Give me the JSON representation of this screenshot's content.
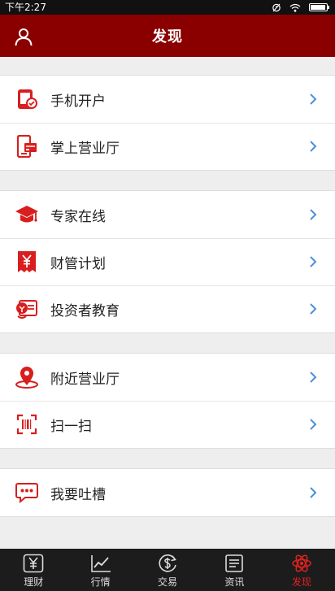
{
  "status": {
    "time": "下午2:27"
  },
  "header": {
    "title": "发现",
    "user_icon": "user-icon"
  },
  "colors": {
    "brand": "#8a0000",
    "accent": "#e02020",
    "chevron": "#4a90d9"
  },
  "groups": [
    {
      "items": [
        {
          "label": "手机开户",
          "icon": "phone-account-icon"
        },
        {
          "label": "掌上营业厅",
          "icon": "mobile-hall-icon"
        }
      ]
    },
    {
      "items": [
        {
          "label": "专家在线",
          "icon": "graduation-cap-icon"
        },
        {
          "label": "财管计划",
          "icon": "yuan-plan-icon"
        },
        {
          "label": "投资者教育",
          "icon": "education-icon"
        }
      ]
    },
    {
      "items": [
        {
          "label": "附近营业厅",
          "icon": "location-pin-icon"
        },
        {
          "label": "扫一扫",
          "icon": "barcode-scan-icon"
        }
      ]
    },
    {
      "items": [
        {
          "label": "我要吐槽",
          "icon": "chat-bubble-icon"
        }
      ]
    }
  ],
  "tabs": [
    {
      "label": "理财",
      "icon": "yuan-icon"
    },
    {
      "label": "行情",
      "icon": "chart-icon"
    },
    {
      "label": "交易",
      "icon": "dollar-exchange-icon"
    },
    {
      "label": "资讯",
      "icon": "news-icon"
    },
    {
      "label": "发现",
      "icon": "discover-icon",
      "active": true
    }
  ]
}
